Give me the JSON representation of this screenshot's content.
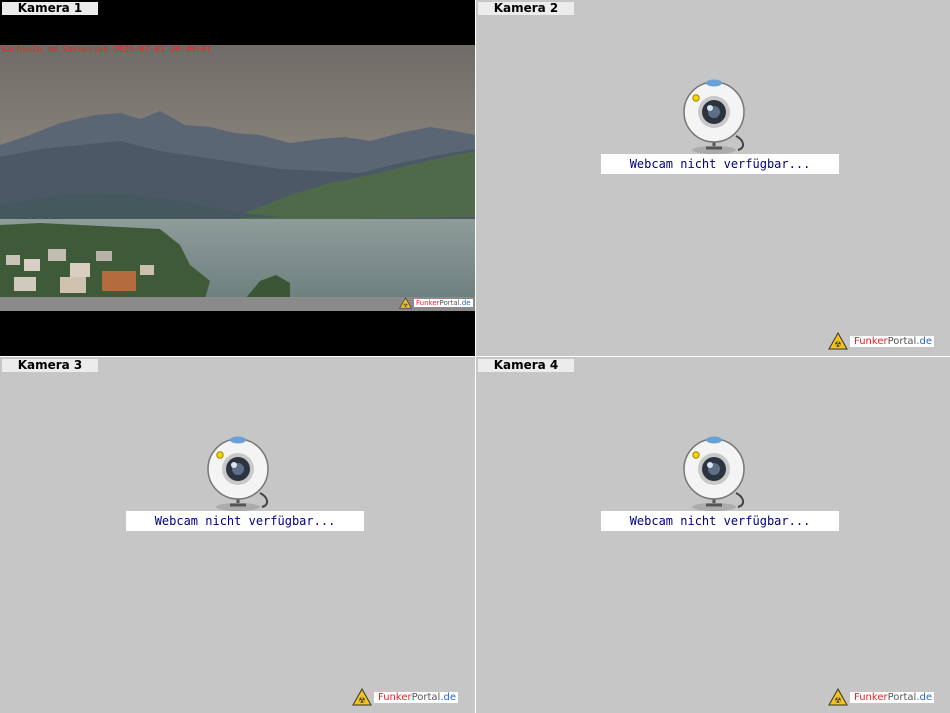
{
  "cameras": [
    {
      "label": "Kamera 1",
      "overlay": "Sachseln am Sarnersee 2025-07-01 20:30:01"
    },
    {
      "label": "Kamera 2",
      "message": "Webcam nicht verfügbar..."
    },
    {
      "label": "Kamera 3",
      "message": "Webcam nicht verfügbar..."
    },
    {
      "label": "Kamera 4",
      "message": "Webcam nicht verfügbar..."
    }
  ],
  "brand": {
    "part1": "Funk",
    "part2": "er",
    "part3": "Portal",
    "part4": ".de"
  },
  "colors": {
    "panel_bg": "#c6c6c6",
    "message_text": "#000080",
    "overlay_text": "#ff1d1d"
  }
}
